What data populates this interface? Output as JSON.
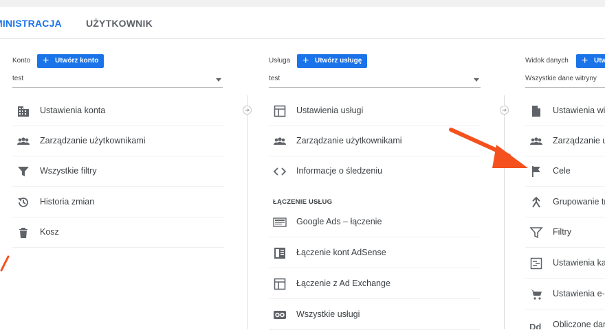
{
  "tabs": {
    "admin": "MINISTRACJA",
    "user": "UŻYTKOWNIK"
  },
  "account": {
    "label": "Konto",
    "create": "Utwórz konto",
    "select_value": "test",
    "items": [
      {
        "label": "Ustawienia konta",
        "icon": "building-icon"
      },
      {
        "label": "Zarządzanie użytkownikami",
        "icon": "users-icon"
      },
      {
        "label": "Wszystkie filtry",
        "icon": "filter-icon"
      },
      {
        "label": "Historia zmian",
        "icon": "history-icon"
      },
      {
        "label": "Kosz",
        "icon": "trash-icon"
      }
    ]
  },
  "property": {
    "label": "Usługa",
    "create": "Utwórz usługę",
    "select_value": "test",
    "items": [
      {
        "label": "Ustawienia usługi",
        "icon": "settings-window-icon"
      },
      {
        "label": "Zarządzanie użytkownikami",
        "icon": "users-icon"
      },
      {
        "label": "Informacje o śledzeniu",
        "icon": "code-icon"
      }
    ],
    "section_title": "ŁĄCZENIE USŁUG",
    "links": [
      {
        "label": "Google Ads – łączenie",
        "icon": "ads-icon"
      },
      {
        "label": "Łączenie kont AdSense",
        "icon": "adsense-icon"
      },
      {
        "label": "Łączenie z Ad Exchange",
        "icon": "adexchange-icon"
      },
      {
        "label": "Wszystkie usługi",
        "icon": "link-icon"
      }
    ]
  },
  "view": {
    "label": "Widok danych",
    "create": "Utw",
    "select_value": "Wszystkie dane witryny",
    "items": [
      {
        "label": "Ustawienia wi",
        "icon": "document-icon"
      },
      {
        "label": "Zarządzanie u",
        "icon": "users-icon"
      },
      {
        "label": "Cele",
        "icon": "flag-icon"
      },
      {
        "label": "Grupowanie tr",
        "icon": "grouping-icon"
      },
      {
        "label": "Filtry",
        "icon": "filter-icon"
      },
      {
        "label": "Ustawienia ka",
        "icon": "channel-settings-icon"
      },
      {
        "label": "Ustawienia e-",
        "icon": "cart-icon"
      },
      {
        "label": "Obliczone dan",
        "icon": "calculated-icon"
      }
    ]
  },
  "colors": {
    "accent": "#1a73e8",
    "tab_underline": "#f4a93b",
    "arrow": "#f4511e",
    "icon": "#5f6368"
  }
}
